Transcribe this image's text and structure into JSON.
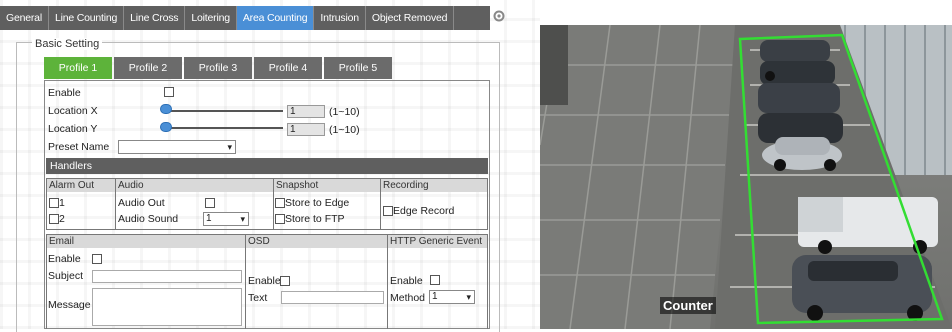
{
  "main_tabs": [
    {
      "label": "General",
      "active": false
    },
    {
      "label": "Line Counting",
      "active": false
    },
    {
      "label": "Line Cross",
      "active": false
    },
    {
      "label": "Loitering",
      "active": false
    },
    {
      "label": "Area Counting",
      "active": true
    },
    {
      "label": "Intrusion",
      "active": false
    },
    {
      "label": "Object Removed",
      "active": false
    }
  ],
  "section_title": "Basic Setting",
  "profile_tabs": [
    {
      "label": "Profile 1",
      "active": true
    },
    {
      "label": "Profile 2",
      "active": false
    },
    {
      "label": "Profile 3",
      "active": false
    },
    {
      "label": "Profile 4",
      "active": false
    },
    {
      "label": "Profile 5",
      "active": false
    }
  ],
  "form": {
    "enable_label": "Enable",
    "location_x_label": "Location X",
    "location_x_value": "1",
    "location_x_range": "(1~10)",
    "location_y_label": "Location Y",
    "location_y_value": "1",
    "location_y_range": "(1~10)",
    "preset_name_label": "Preset Name",
    "preset_name_value": ""
  },
  "handlers": {
    "title": "Handlers",
    "alarm_out": {
      "label": "Alarm Out",
      "opt1": "1",
      "opt2": "2"
    },
    "audio": {
      "label": "Audio",
      "audio_out": "Audio Out",
      "audio_sound": "Audio Sound",
      "audio_sound_value": "1"
    },
    "snapshot": {
      "label": "Snapshot",
      "store_edge": "Store to Edge",
      "store_ftp": "Store to FTP"
    },
    "recording": {
      "label": "Recording",
      "edge_record": "Edge Record"
    }
  },
  "email": {
    "label": "Email",
    "enable": "Enable",
    "subject": "Subject",
    "message": "Message"
  },
  "osd": {
    "label": "OSD",
    "enable": "Enable",
    "text": "Text"
  },
  "http": {
    "label": "HTTP Generic Event",
    "enable": "Enable",
    "method": "Method",
    "method_value": "1"
  },
  "camera": {
    "overlay_label": "Counter",
    "zone_color": "#33dd33"
  },
  "colors": {
    "active_tab": "#4a8fd6",
    "active_profile": "#5db33a",
    "tab_bg": "#5f5f5f"
  }
}
